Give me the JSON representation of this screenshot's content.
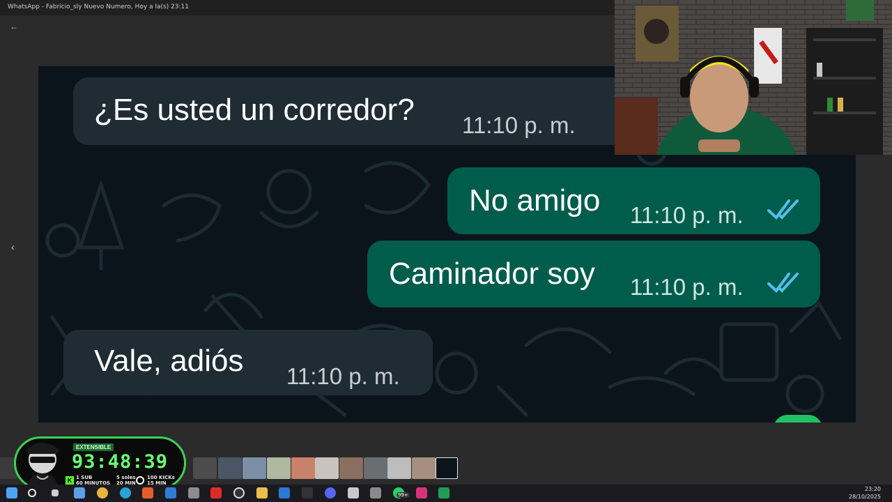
{
  "window": {
    "title": "WhatsApp - Fabricio_sly Nuevo Numero, Hoy a la(s) 23:11"
  },
  "chat": {
    "messages": [
      {
        "direction": "incoming",
        "text": "¿Es usted un corredor?",
        "time": "11:10 p. m."
      },
      {
        "direction": "outgoing",
        "text": "No amigo",
        "time": "11:10 p. m.",
        "status": "read"
      },
      {
        "direction": "outgoing",
        "text": "Caminador soy",
        "time": "11:10 p. m.",
        "status": "read"
      },
      {
        "direction": "incoming",
        "text": "Vale, adiós",
        "time": "11:10 p. m."
      }
    ]
  },
  "timer": {
    "badge": "EXTENSIBLE",
    "time": "93:48:39",
    "rule_sub": "1 SUB\n60 MINUTOS",
    "rule_soles": "5 soles\n20 MIN",
    "rule_kicks": "100 KICKs\n15 MIN"
  },
  "taskbar": {
    "clock": "23:20",
    "date": "28/10/2025",
    "badge": "99+"
  },
  "colors": {
    "incoming_bubble": "#1f2c34",
    "outgoing_bubble": "#005c4b",
    "chat_background": "#0b141a",
    "read_ticks": "#53bdeb",
    "timer_accent": "#39d353"
  }
}
